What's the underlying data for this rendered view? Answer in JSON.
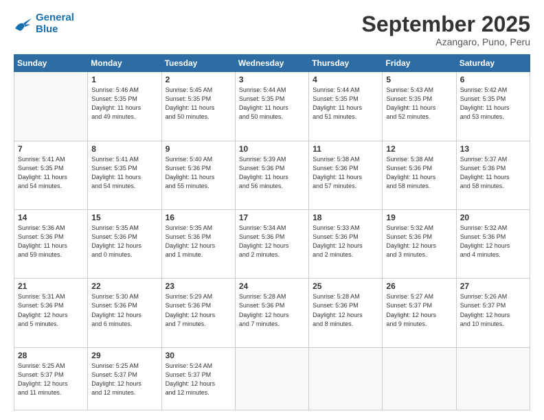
{
  "logo": {
    "line1": "General",
    "line2": "Blue"
  },
  "header": {
    "month": "September 2025",
    "location": "Azangaro, Puno, Peru"
  },
  "weekdays": [
    "Sunday",
    "Monday",
    "Tuesday",
    "Wednesday",
    "Thursday",
    "Friday",
    "Saturday"
  ],
  "weeks": [
    [
      {
        "day": "",
        "info": ""
      },
      {
        "day": "1",
        "info": "Sunrise: 5:46 AM\nSunset: 5:35 PM\nDaylight: 11 hours\nand 49 minutes."
      },
      {
        "day": "2",
        "info": "Sunrise: 5:45 AM\nSunset: 5:35 PM\nDaylight: 11 hours\nand 50 minutes."
      },
      {
        "day": "3",
        "info": "Sunrise: 5:44 AM\nSunset: 5:35 PM\nDaylight: 11 hours\nand 50 minutes."
      },
      {
        "day": "4",
        "info": "Sunrise: 5:44 AM\nSunset: 5:35 PM\nDaylight: 11 hours\nand 51 minutes."
      },
      {
        "day": "5",
        "info": "Sunrise: 5:43 AM\nSunset: 5:35 PM\nDaylight: 11 hours\nand 52 minutes."
      },
      {
        "day": "6",
        "info": "Sunrise: 5:42 AM\nSunset: 5:35 PM\nDaylight: 11 hours\nand 53 minutes."
      }
    ],
    [
      {
        "day": "7",
        "info": "Sunrise: 5:41 AM\nSunset: 5:35 PM\nDaylight: 11 hours\nand 54 minutes."
      },
      {
        "day": "8",
        "info": "Sunrise: 5:41 AM\nSunset: 5:35 PM\nDaylight: 11 hours\nand 54 minutes."
      },
      {
        "day": "9",
        "info": "Sunrise: 5:40 AM\nSunset: 5:36 PM\nDaylight: 11 hours\nand 55 minutes."
      },
      {
        "day": "10",
        "info": "Sunrise: 5:39 AM\nSunset: 5:36 PM\nDaylight: 11 hours\nand 56 minutes."
      },
      {
        "day": "11",
        "info": "Sunrise: 5:38 AM\nSunset: 5:36 PM\nDaylight: 11 hours\nand 57 minutes."
      },
      {
        "day": "12",
        "info": "Sunrise: 5:38 AM\nSunset: 5:36 PM\nDaylight: 11 hours\nand 58 minutes."
      },
      {
        "day": "13",
        "info": "Sunrise: 5:37 AM\nSunset: 5:36 PM\nDaylight: 11 hours\nand 58 minutes."
      }
    ],
    [
      {
        "day": "14",
        "info": "Sunrise: 5:36 AM\nSunset: 5:36 PM\nDaylight: 11 hours\nand 59 minutes."
      },
      {
        "day": "15",
        "info": "Sunrise: 5:35 AM\nSunset: 5:36 PM\nDaylight: 12 hours\nand 0 minutes."
      },
      {
        "day": "16",
        "info": "Sunrise: 5:35 AM\nSunset: 5:36 PM\nDaylight: 12 hours\nand 1 minute."
      },
      {
        "day": "17",
        "info": "Sunrise: 5:34 AM\nSunset: 5:36 PM\nDaylight: 12 hours\nand 2 minutes."
      },
      {
        "day": "18",
        "info": "Sunrise: 5:33 AM\nSunset: 5:36 PM\nDaylight: 12 hours\nand 2 minutes."
      },
      {
        "day": "19",
        "info": "Sunrise: 5:32 AM\nSunset: 5:36 PM\nDaylight: 12 hours\nand 3 minutes."
      },
      {
        "day": "20",
        "info": "Sunrise: 5:32 AM\nSunset: 5:36 PM\nDaylight: 12 hours\nand 4 minutes."
      }
    ],
    [
      {
        "day": "21",
        "info": "Sunrise: 5:31 AM\nSunset: 5:36 PM\nDaylight: 12 hours\nand 5 minutes."
      },
      {
        "day": "22",
        "info": "Sunrise: 5:30 AM\nSunset: 5:36 PM\nDaylight: 12 hours\nand 6 minutes."
      },
      {
        "day": "23",
        "info": "Sunrise: 5:29 AM\nSunset: 5:36 PM\nDaylight: 12 hours\nand 7 minutes."
      },
      {
        "day": "24",
        "info": "Sunrise: 5:28 AM\nSunset: 5:36 PM\nDaylight: 12 hours\nand 7 minutes."
      },
      {
        "day": "25",
        "info": "Sunrise: 5:28 AM\nSunset: 5:36 PM\nDaylight: 12 hours\nand 8 minutes."
      },
      {
        "day": "26",
        "info": "Sunrise: 5:27 AM\nSunset: 5:37 PM\nDaylight: 12 hours\nand 9 minutes."
      },
      {
        "day": "27",
        "info": "Sunrise: 5:26 AM\nSunset: 5:37 PM\nDaylight: 12 hours\nand 10 minutes."
      }
    ],
    [
      {
        "day": "28",
        "info": "Sunrise: 5:25 AM\nSunset: 5:37 PM\nDaylight: 12 hours\nand 11 minutes."
      },
      {
        "day": "29",
        "info": "Sunrise: 5:25 AM\nSunset: 5:37 PM\nDaylight: 12 hours\nand 12 minutes."
      },
      {
        "day": "30",
        "info": "Sunrise: 5:24 AM\nSunset: 5:37 PM\nDaylight: 12 hours\nand 12 minutes."
      },
      {
        "day": "",
        "info": ""
      },
      {
        "day": "",
        "info": ""
      },
      {
        "day": "",
        "info": ""
      },
      {
        "day": "",
        "info": ""
      }
    ]
  ]
}
